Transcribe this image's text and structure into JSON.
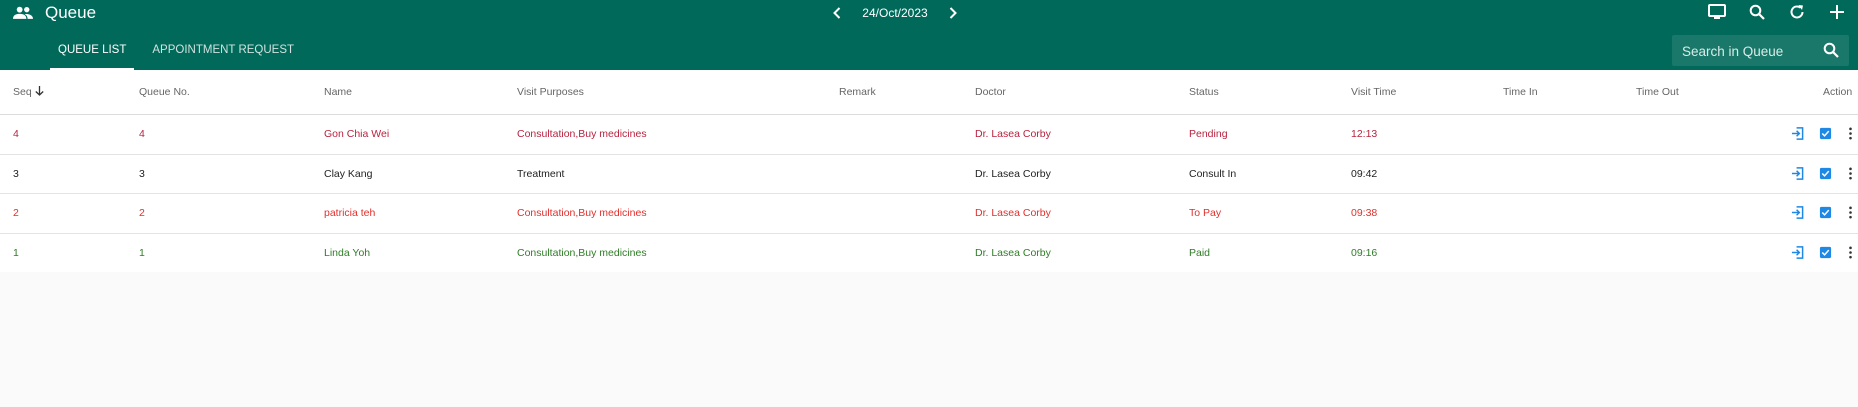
{
  "header": {
    "title": "Queue",
    "title_icon": "people-icon",
    "date": "24/Oct/2023",
    "icons": [
      "monitor-icon",
      "search-icon",
      "refresh-icon",
      "add-icon"
    ]
  },
  "tabs": [
    {
      "label": "QUEUE LIST",
      "active": true
    },
    {
      "label": "APPOINTMENT REQUEST",
      "active": false
    }
  ],
  "search": {
    "placeholder": "Search in Queue"
  },
  "columns": {
    "seq": "Seq",
    "queue_no": "Queue No.",
    "name": "Name",
    "visit_purposes": "Visit Purposes",
    "remark": "Remark",
    "doctor": "Doctor",
    "status": "Status",
    "visit_time": "Visit Time",
    "time_in": "Time In",
    "time_out": "Time Out",
    "action": "Action"
  },
  "rows": [
    {
      "seq": "4",
      "queue_no": "4",
      "name": "Gon Chia Wei",
      "visit_purposes": "Consultation,Buy medicines",
      "remark": "",
      "doctor": "Dr. Lasea Corby",
      "status": "Pending",
      "visit_time": "12:13",
      "time_in": "",
      "time_out": ""
    },
    {
      "seq": "3",
      "queue_no": "3",
      "name": "Clay Kang",
      "visit_purposes": "Treatment",
      "remark": "",
      "doctor": "Dr. Lasea Corby",
      "status": "Consult In",
      "visit_time": "09:42",
      "time_in": "",
      "time_out": ""
    },
    {
      "seq": "2",
      "queue_no": "2",
      "name": "patricia teh",
      "visit_purposes": "Consultation,Buy medicines",
      "remark": "",
      "doctor": "Dr. Lasea Corby",
      "status": "To Pay",
      "visit_time": "09:38",
      "time_in": "",
      "time_out": ""
    },
    {
      "seq": "1",
      "queue_no": "1",
      "name": "Linda Yoh",
      "visit_purposes": "Consultation,Buy medicines",
      "remark": "",
      "doctor": "Dr. Lasea Corby",
      "status": "Paid",
      "visit_time": "09:16",
      "time_in": "",
      "time_out": ""
    }
  ],
  "colors": {
    "primary": "#01695a",
    "pending": "#b8233f",
    "consult_in": "#222222",
    "to_pay": "#e0302d",
    "paid": "#2f7d27",
    "action_icon": "#1e88e5"
  }
}
